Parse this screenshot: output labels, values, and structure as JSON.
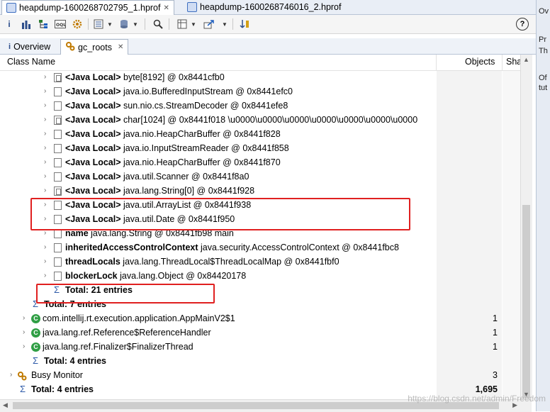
{
  "editor_tabs": [
    {
      "label": "heapdump-1600268702795_1.hprof",
      "close": "✕"
    },
    {
      "label": "heapdump-1600268746016_2.hprof"
    }
  ],
  "view_tabs": [
    {
      "label": "Overview"
    },
    {
      "label": "gc_roots",
      "close": "✕"
    }
  ],
  "table": {
    "col_class_name": "Class Name",
    "col_objects": "Objects",
    "col_shallow": "Sha"
  },
  "rows": [
    {
      "kind": "local",
      "level": 2,
      "bold": "<Java Local>",
      "text": "byte[8192] @ 0x8441cfb0"
    },
    {
      "kind": "local",
      "level": 2,
      "bold": "<Java Local>",
      "text": "java.io.BufferedInputStream @ 0x8441efc0"
    },
    {
      "kind": "local",
      "level": 2,
      "bold": "<Java Local>",
      "text": "sun.nio.cs.StreamDecoder @ 0x8441efe8"
    },
    {
      "kind": "local",
      "level": 2,
      "bold": "<Java Local>",
      "text": "char[1024] @ 0x8441f018  \\u0000\\u0000\\u0000\\u0000\\u0000\\u0000\\u0000"
    },
    {
      "kind": "local",
      "level": 2,
      "bold": "<Java Local>",
      "text": "java.nio.HeapCharBuffer @ 0x8441f828"
    },
    {
      "kind": "local",
      "level": 2,
      "bold": "<Java Local>",
      "text": "java.io.InputStreamReader @ 0x8441f858"
    },
    {
      "kind": "local",
      "level": 2,
      "bold": "<Java Local>",
      "text": "java.nio.HeapCharBuffer @ 0x8441f870"
    },
    {
      "kind": "local",
      "level": 2,
      "bold": "<Java Local>",
      "text": "java.util.Scanner @ 0x8441f8a0"
    },
    {
      "kind": "local",
      "level": 2,
      "bold": "<Java Local>",
      "text": "java.lang.String[0] @ 0x8441f928"
    },
    {
      "kind": "local",
      "level": 2,
      "bold": "<Java Local>",
      "text": "java.util.ArrayList @ 0x8441f938"
    },
    {
      "kind": "local",
      "level": 2,
      "bold": "<Java Local>",
      "text": "java.util.Date @ 0x8441f950"
    },
    {
      "kind": "field",
      "level": 2,
      "bold": "name",
      "text": "java.lang.String @ 0x8441fb98  main"
    },
    {
      "kind": "field",
      "level": 2,
      "bold": "inheritedAccessControlContext",
      "text": "java.security.AccessControlContext @ 0x8441fbc8"
    },
    {
      "kind": "field",
      "level": 2,
      "bold": "threadLocals",
      "text": "java.lang.ThreadLocal$ThreadLocalMap @ 0x8441fbf0"
    },
    {
      "kind": "field",
      "level": 2,
      "bold": "blockerLock",
      "text": "java.lang.Object @ 0x84420178"
    },
    {
      "kind": "total",
      "level": 2,
      "bold": "Total: 21 entries",
      "text": ""
    },
    {
      "kind": "total",
      "level": 1,
      "bold": "Total: 7 entries",
      "text": ""
    },
    {
      "kind": "class",
      "level": 1,
      "bold": "",
      "text": "com.intellij.rt.execution.application.AppMainV2$1",
      "objects": "1"
    },
    {
      "kind": "class",
      "level": 1,
      "bold": "",
      "text": "java.lang.ref.Reference$ReferenceHandler",
      "objects": "1"
    },
    {
      "kind": "class",
      "level": 1,
      "bold": "",
      "text": "java.lang.ref.Finalizer$FinalizerThread",
      "objects": "1"
    },
    {
      "kind": "total",
      "level": 1,
      "bold": "Total: 4 entries",
      "text": ""
    },
    {
      "kind": "group",
      "level": 0,
      "bold": "",
      "text": "Busy Monitor",
      "objects": "3"
    },
    {
      "kind": "total",
      "level": 0,
      "bold": "Total: 4 entries",
      "text": "",
      "objects": "1,695"
    }
  ],
  "side_panel": [
    "Ov",
    "Pr",
    "Th",
    "Of",
    "tut"
  ],
  "watermark": "https://blog.csdn.net/admin/Freedom",
  "colors": {
    "highlight": "#e02020",
    "class_icon": "#2f9e44",
    "sigma": "#2d5aa8"
  }
}
